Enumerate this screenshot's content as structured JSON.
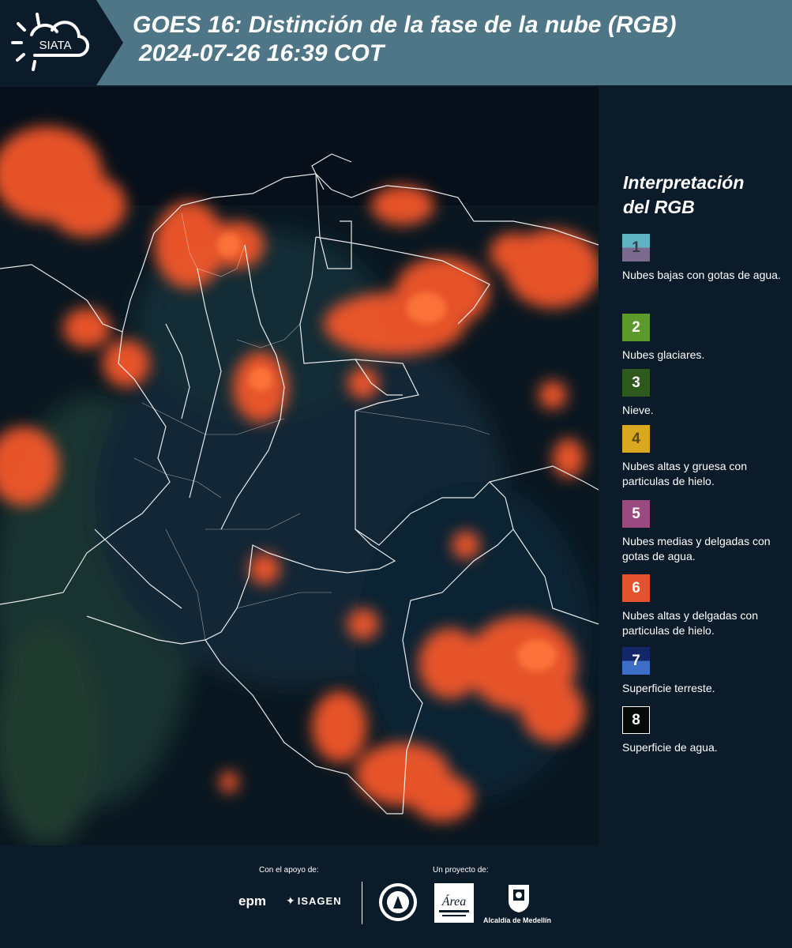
{
  "header": {
    "logo_text": "SIATA",
    "title_line1": "GOES 16: Distinción de la fase de la nube (RGB)",
    "title_line2": "2024-07-26 16:39 COT"
  },
  "legend": {
    "title_line1": "Interpretación",
    "title_line2": "del RGB",
    "items": [
      {
        "number": "1",
        "label": "Nubes bajas con gotas de agua.",
        "color_top": "#5fb3c2",
        "color_bottom": "#7a6a8e"
      },
      {
        "number": "2",
        "label": "Nubes glaciares.",
        "color_top": "#5c9a2a",
        "color_bottom": "#5c9a2a"
      },
      {
        "number": "3",
        "label": "Nieve.",
        "color_top": "#2d5a1c",
        "color_bottom": "#2d5a1c"
      },
      {
        "number": "4",
        "label": "Nubes altas y gruesa con particulas de hielo.",
        "color_top": "#d9a81f",
        "color_bottom": "#d9a81f"
      },
      {
        "number": "5",
        "label": "Nubes medias y delgadas con gotas de agua.",
        "color_top": "#9a4a7e",
        "color_bottom": "#9a4a7e"
      },
      {
        "number": "6",
        "label": "Nubes altas y delgadas con particulas de hielo.",
        "color_top": "#e4532f",
        "color_bottom": "#e4532f"
      },
      {
        "number": "7",
        "label": "Superficie terreste.",
        "color_top": "#13266a",
        "color_bottom": "#3e6fc8"
      },
      {
        "number": "8",
        "label": "Superficie de agua.",
        "color_top": "#050a08",
        "color_bottom": "#050a08"
      }
    ]
  },
  "footer": {
    "support_label": "Con el apoyo de:",
    "project_label": "Un proyecto de:",
    "epm_logo_text": "epm",
    "isagen_logo_text": "ISAGEN",
    "alcaldia_label": "Alcaldía de Medellín",
    "area_logo_text": "Área"
  },
  "colors": {
    "header_bg": "#4e7686",
    "page_bg": "#0c1b29",
    "cloud_red": "#ff5a2c",
    "border_white": "#ffffff"
  }
}
